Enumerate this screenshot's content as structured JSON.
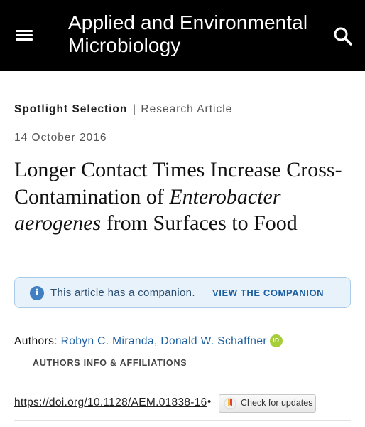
{
  "header": {
    "journal_title": "Applied and Environmental Microbiology",
    "menu_icon": "hamburger-menu-icon",
    "search_icon": "search-icon",
    "background": "#000000"
  },
  "article": {
    "type_primary": "Spotlight Selection",
    "separator": "|",
    "type_secondary": "Research Article",
    "date": "14 October 2016",
    "title_part1": "Longer Contact Times Increase Cross-Contamination of ",
    "title_italic": "Enterobacter aerogenes",
    "title_part2": " from Surfaces to Food"
  },
  "companion_banner": {
    "icon": "info-icon",
    "text": "This article has a companion.",
    "link": "VIEW THE COMPANION",
    "background": "#e8f2fb",
    "accent": "#1d5fa0"
  },
  "authors": {
    "label": "Authors",
    "colon": ":",
    "list": [
      {
        "name": "Robyn C. Miranda",
        "suffix": ","
      },
      {
        "name": "Donald W. Schaffner",
        "suffix": ""
      }
    ],
    "orcid_icon": "orcid-icon",
    "orcid_text": "iD",
    "affiliations_link": "AUTHORS INFO & AFFILIATIONS"
  },
  "doi": {
    "url": "https://doi.org/10.1128/AEM.01838-16",
    "bullet": "•",
    "check_updates_label": "Check for updates",
    "check_updates_icon": "crossmark-icon"
  }
}
